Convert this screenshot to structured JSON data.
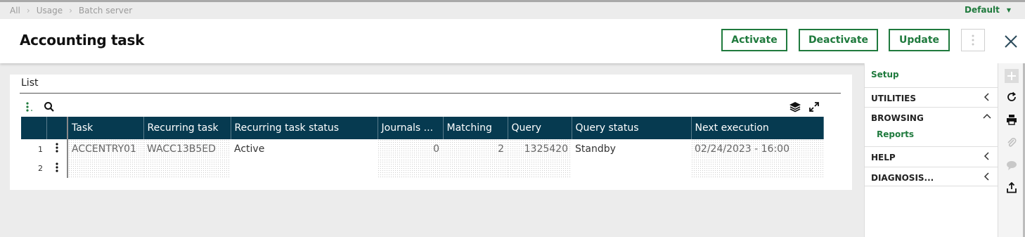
{
  "breadcrumb": [
    "All",
    "Usage",
    "Batch server"
  ],
  "profile": {
    "label": "Default"
  },
  "page": {
    "title": "Accounting task"
  },
  "actions": {
    "activate": "Activate",
    "deactivate": "Deactivate",
    "update": "Update"
  },
  "list": {
    "title": "List",
    "columns": [
      "Task",
      "Recurring task",
      "Recurring task status",
      "Journals ...",
      "Matching",
      "Query",
      "Query status",
      "Next execution"
    ],
    "rows": [
      {
        "num": "1",
        "task": "ACCENTRY01",
        "recurring_task": "WACC13B5ED",
        "status": "Active",
        "journals": "0",
        "matching": "2",
        "query": "1325420",
        "query_status": "Standby",
        "next_execution": "02/24/2023 - 16:00"
      },
      {
        "num": "2",
        "task": "",
        "recurring_task": "",
        "status": "",
        "journals": "",
        "matching": "",
        "query": "",
        "query_status": "",
        "next_execution": ""
      }
    ]
  },
  "sidebar": {
    "setup": "Setup",
    "sections": [
      {
        "label": "UTILITIES",
        "state": "collapsed"
      },
      {
        "label": "BROWSING",
        "state": "expanded"
      },
      {
        "label": "HELP",
        "state": "collapsed"
      },
      {
        "label": "DIAGNOSIS...",
        "state": "collapsed"
      }
    ],
    "browsing_links": [
      "Reports"
    ]
  },
  "rail_icons": [
    "plus-icon",
    "refresh-icon",
    "print-icon",
    "attachment-icon",
    "comment-icon",
    "export-icon"
  ],
  "colors": {
    "accent": "#1f7a3d",
    "grid_header": "#063a50"
  }
}
